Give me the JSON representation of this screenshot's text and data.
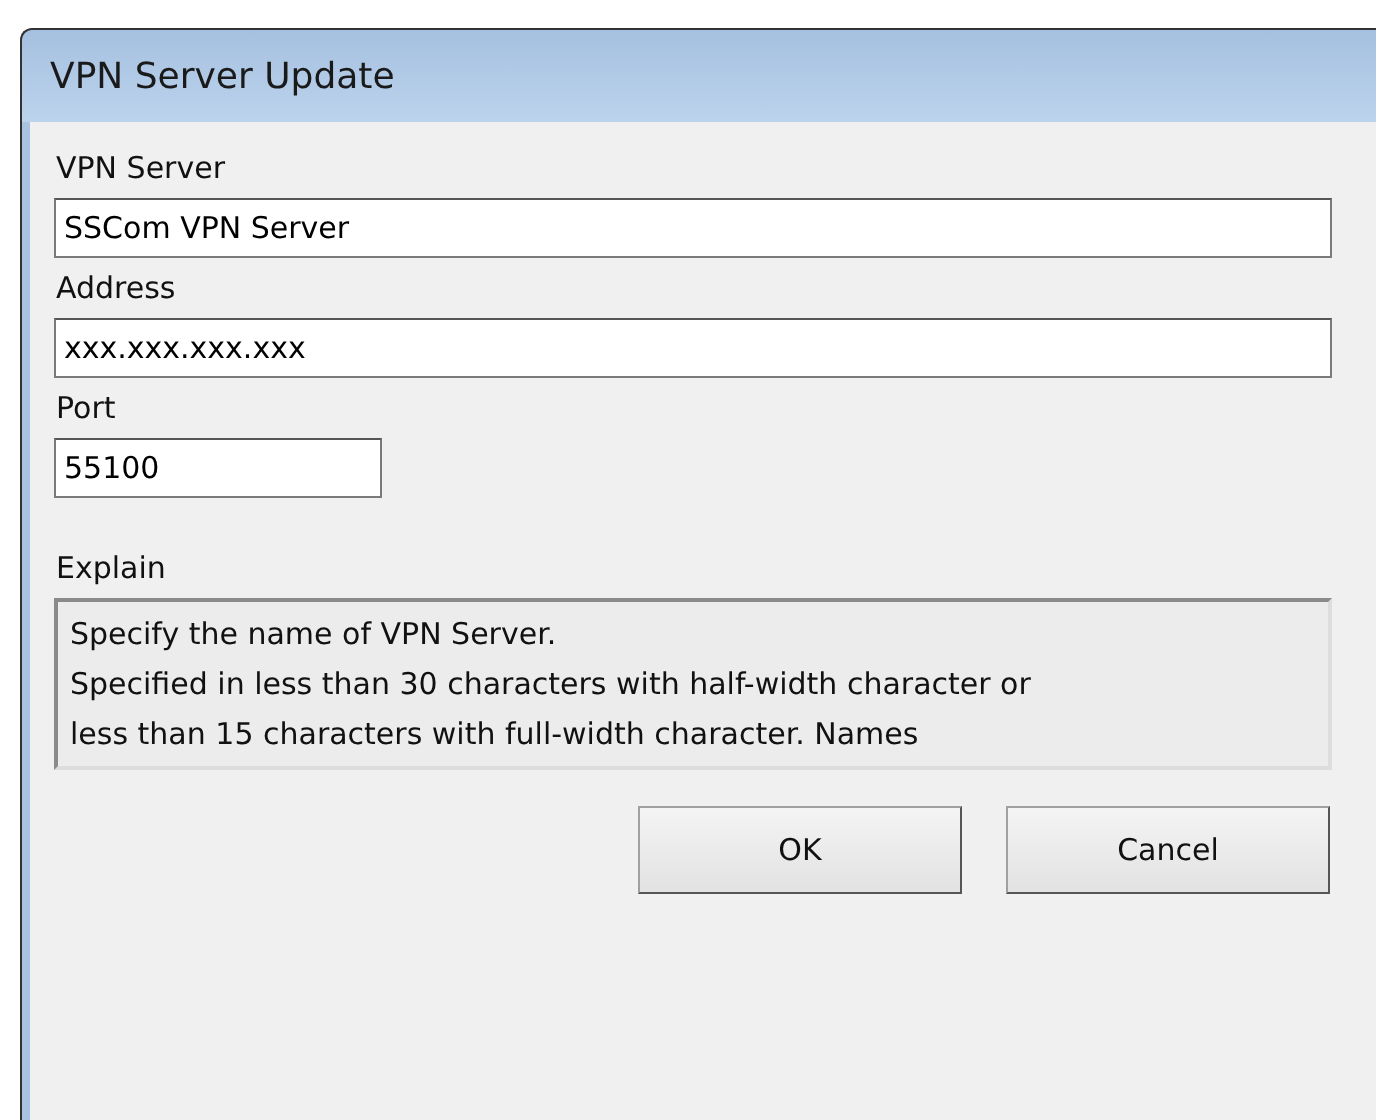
{
  "window": {
    "title": "VPN Server Update"
  },
  "fields": [
    {
      "label": "VPN Server",
      "value": "SSCom VPN Server",
      "kind": "wide"
    },
    {
      "label": "Address",
      "value": "xxx.xxx.xxx.xxx",
      "kind": "wide"
    },
    {
      "label": "Port",
      "value": "55100",
      "kind": "short"
    }
  ],
  "explain": {
    "label": "Explain",
    "lines": [
      "Specify the name of VPN Server.",
      "Specified in less than 30 characters with half-width character or",
      "less than 15 characters with full-width character. Names"
    ]
  },
  "buttons": [
    "OK",
    "Cancel"
  ]
}
